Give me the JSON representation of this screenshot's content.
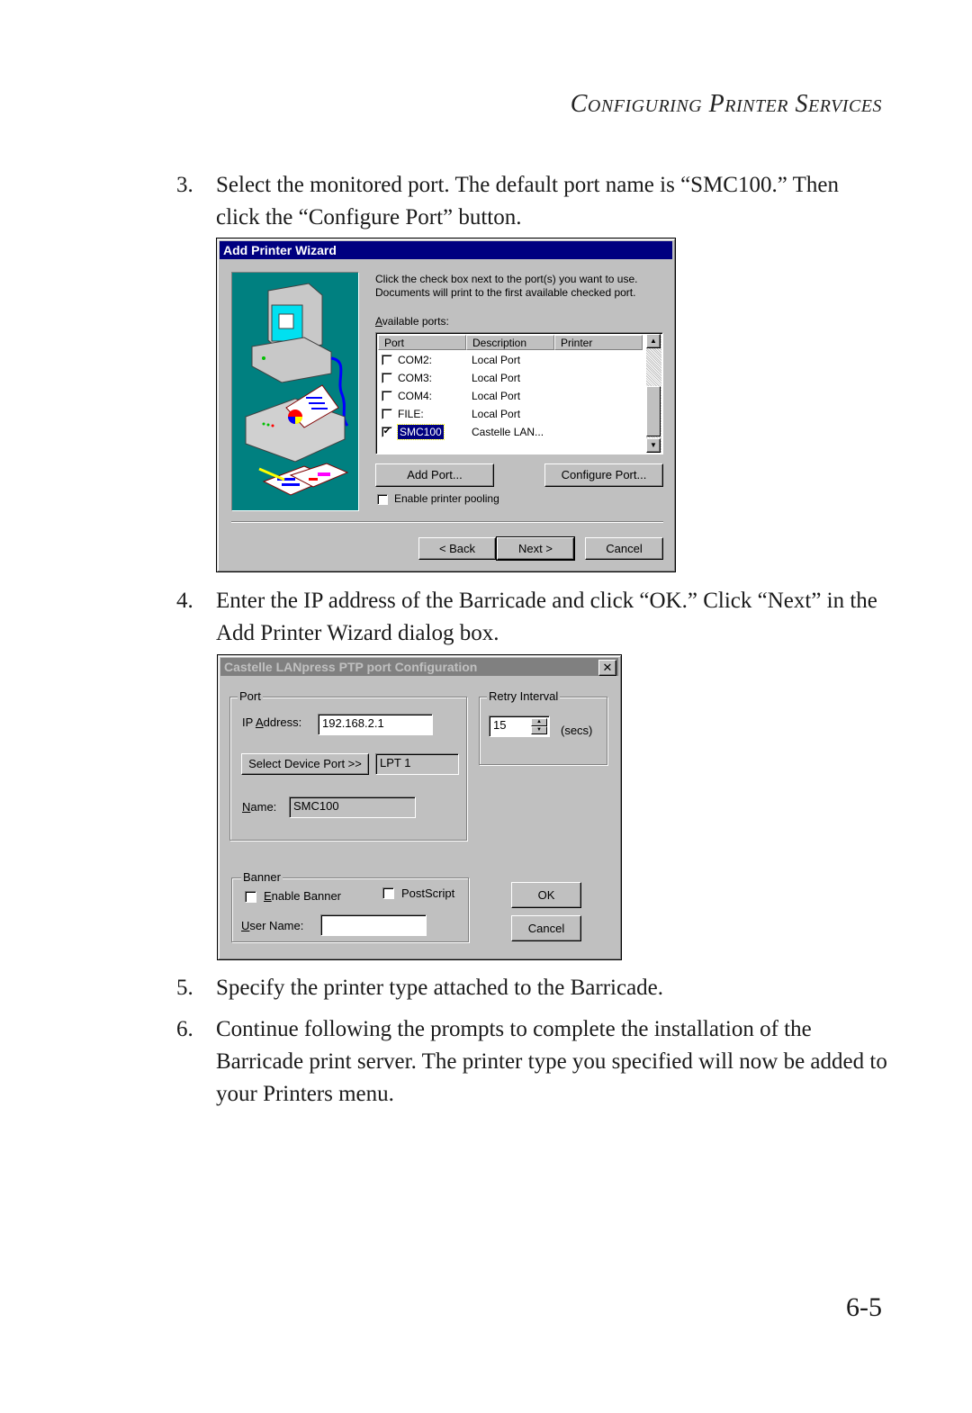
{
  "page": {
    "running_head": "Configuring Printer Services",
    "page_number": "6-5"
  },
  "steps": [
    {
      "num": "3.",
      "text": "Select the monitored port. The default port name is “SMC100.” Then click the “Configure Port” button."
    },
    {
      "num": "4.",
      "text": "Enter the IP address of the Barricade and click “OK.” Click  “Next” in the Add Printer Wizard dialog box."
    },
    {
      "num": "5.",
      "text": "Specify the printer type attached to the Barricade."
    },
    {
      "num": "6.",
      "text": "Continue following the prompts to complete the installation of the Barricade print server. The printer type you specified will now be added to your Printers menu."
    }
  ],
  "wizard": {
    "title": "Add Printer Wizard",
    "instruction_line1": "Click the check box next to the port(s) you want to use.",
    "instruction_line2": "Documents will print to the first available checked port.",
    "available_ports_label": "Available ports:",
    "columns": [
      "Port",
      "Description",
      "Printer"
    ],
    "ports": [
      {
        "port": "COM2:",
        "description": "Local Port",
        "printer": "",
        "checked": false
      },
      {
        "port": "COM3:",
        "description": "Local Port",
        "printer": "",
        "checked": false
      },
      {
        "port": "COM4:",
        "description": "Local Port",
        "printer": "",
        "checked": false
      },
      {
        "port": "FILE:",
        "description": "Local Port",
        "printer": "",
        "checked": false
      },
      {
        "port": "SMC100",
        "description": "Castelle LAN...",
        "printer": "",
        "checked": true,
        "selected": true
      }
    ],
    "add_port_label": "Add Port...",
    "configure_port_label": "Configure Port...",
    "pooling_label": "Enable printer pooling",
    "pooling_checked": false,
    "back_label": "< Back",
    "next_label": "Next >",
    "cancel_label": "Cancel",
    "scroll_up_icon": "▲",
    "scroll_down_icon": "▼"
  },
  "config": {
    "title": "Castelle LANpress PTP port  Configuration",
    "close_icon": "✕",
    "port_group_label": "Port",
    "ip_label": "IP Address:",
    "ip_value": "192.168.2.1",
    "select_device_label": "Select Device Port >>",
    "device_port_value": "LPT 1",
    "name_label": "Name:",
    "name_value": "SMC100",
    "retry_group_label": "Retry Interval",
    "retry_value": "15",
    "retry_unit": "(secs)",
    "banner_group_label": "Banner",
    "enable_banner_label": "Enable Banner",
    "enable_banner_checked": false,
    "postscript_label": "PostScript",
    "postscript_checked": false,
    "user_name_label": "User Name:",
    "user_name_value": "",
    "ok_label": "OK",
    "cancel_label": "Cancel"
  }
}
